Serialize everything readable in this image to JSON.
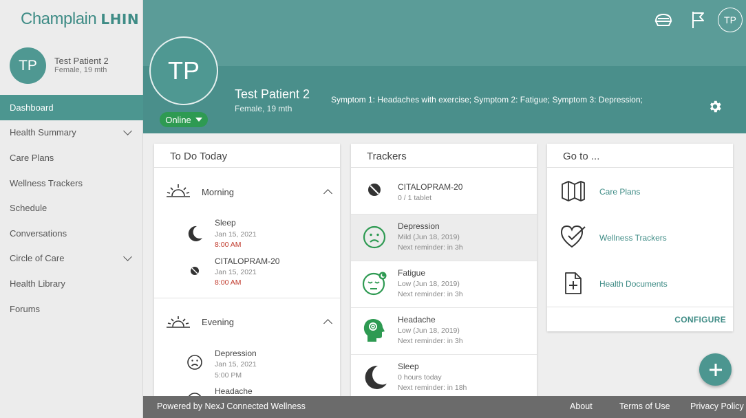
{
  "brand": {
    "name": "Champlain",
    "suffix": "LHIN"
  },
  "sidebar": {
    "avatar": "TP",
    "name": "Test Patient 2",
    "sub": "Female, 19 mth",
    "items": [
      {
        "label": "Dashboard"
      },
      {
        "label": "Health Summary"
      },
      {
        "label": "Care Plans"
      },
      {
        "label": "Wellness Trackers"
      },
      {
        "label": "Schedule"
      },
      {
        "label": "Conversations"
      },
      {
        "label": "Circle of Care"
      },
      {
        "label": "Health Library"
      },
      {
        "label": "Forums"
      }
    ]
  },
  "header": {
    "avatar": "TP",
    "status": "Online",
    "name": "Test Patient 2",
    "sub": "Female, 19 mth",
    "symptoms": "Symptom 1: Headaches with exercise; Symptom 2: Fatigue; Symptom 3: Depression;",
    "user_initials": "TP"
  },
  "todo": {
    "title": "To Do Today",
    "morning": {
      "label": "Morning",
      "items": [
        {
          "title": "Sleep",
          "date": "Jan 15, 2021",
          "time": "8:00 AM"
        },
        {
          "title": "CITALOPRAM-20",
          "date": "Jan 15, 2021",
          "time": "8:00 AM"
        }
      ]
    },
    "evening": {
      "label": "Evening",
      "items": [
        {
          "title": "Depression",
          "date": "Jan 15, 2021",
          "time": "5:00 PM"
        },
        {
          "title": "Headache"
        }
      ]
    }
  },
  "trackers": {
    "title": "Trackers",
    "items": [
      {
        "title": "CITALOPRAM-20",
        "line1": "0 / 1 tablet",
        "line2": ""
      },
      {
        "title": "Depression",
        "line1": "Mild (Jun 18, 2019)",
        "line2": "Next reminder: in 3h"
      },
      {
        "title": "Fatigue",
        "line1": "Low (Jun 18, 2019)",
        "line2": "Next reminder: in 3h"
      },
      {
        "title": "Headache",
        "line1": "Low (Jun 18, 2019)",
        "line2": "Next reminder: in 3h"
      },
      {
        "title": "Sleep",
        "line1": "0 hours today",
        "line2": "Next reminder: in 18h"
      }
    ]
  },
  "goto": {
    "title": "Go to ...",
    "links": [
      {
        "label": "Care Plans"
      },
      {
        "label": "Wellness Trackers"
      },
      {
        "label": "Health Documents"
      }
    ],
    "configure": "CONFIGURE"
  },
  "footer": {
    "powered": "Powered by NexJ Connected Wellness",
    "about": "About",
    "terms": "Terms of Use",
    "privacy": "Privacy Policy"
  },
  "colors": {
    "teal": "#4c9690",
    "online": "#2e9a52",
    "time": "#c0392b"
  }
}
